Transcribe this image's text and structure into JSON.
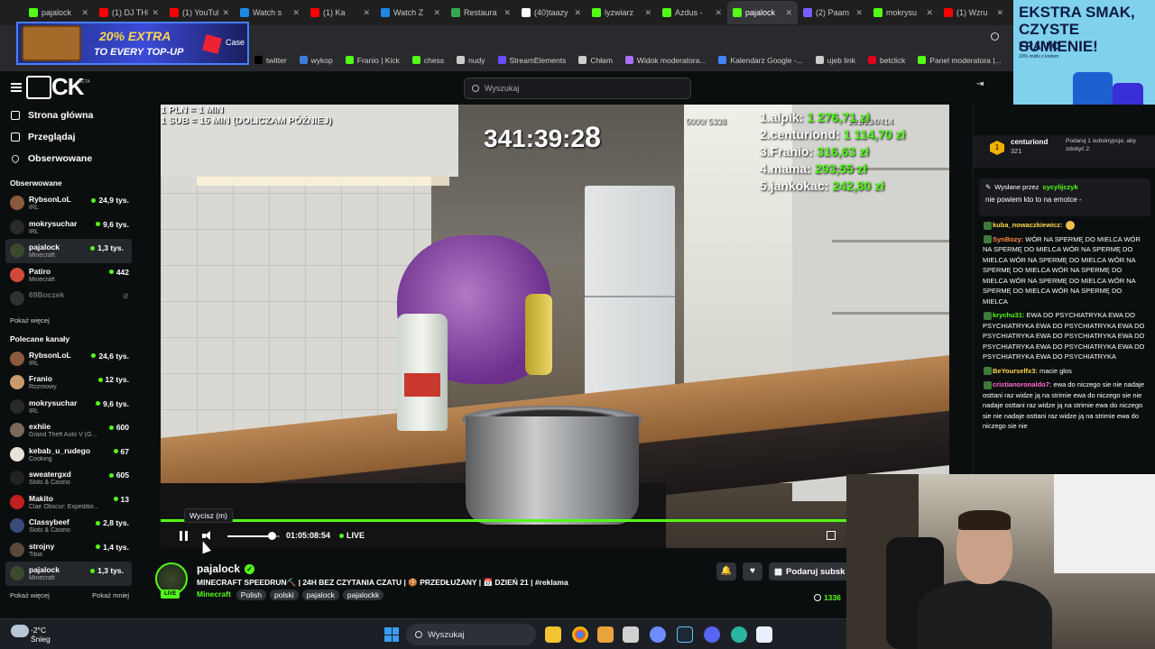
{
  "browser_tabs": [
    {
      "label": "pajalock",
      "color": "#53fc18",
      "active": false
    },
    {
      "label": "(1) DJ THE",
      "color": "#ff0000",
      "active": false
    },
    {
      "label": "(1) YouTube",
      "color": "#ff0000",
      "active": false
    },
    {
      "label": "Watch s",
      "color": "#1e88e5",
      "active": false
    },
    {
      "label": "(1) Ka",
      "color": "#ff0000",
      "active": false
    },
    {
      "label": "Watch Z",
      "color": "#1e88e5",
      "active": false
    },
    {
      "label": "Restaura",
      "color": "#34a853",
      "active": false
    },
    {
      "label": "(40)taazy",
      "color": "#ffffff",
      "active": false
    },
    {
      "label": "lyzwiarz",
      "color": "#53fc18",
      "active": false
    },
    {
      "label": "Azdus -",
      "color": "#53fc18",
      "active": false
    },
    {
      "label": "pajalock",
      "color": "#53fc18",
      "active": true
    },
    {
      "label": "(2) Paam",
      "color": "#7b5cff",
      "active": false
    },
    {
      "label": "mokrysu",
      "color": "#53fc18",
      "active": false
    },
    {
      "label": "(1) Wzru",
      "color": "#ff0000",
      "active": false
    }
  ],
  "bookmarks": [
    {
      "label": "twitter",
      "color": "#000000"
    },
    {
      "label": "wykop",
      "color": "#3b7dd8"
    },
    {
      "label": "Franio | Kick",
      "color": "#53fc18"
    },
    {
      "label": "chess",
      "color": "#53fc18"
    },
    {
      "label": "nudy",
      "color": "#cccccc"
    },
    {
      "label": "StreamElements",
      "color": "#6b4cff"
    },
    {
      "label": "Chłam",
      "color": "#cccccc"
    },
    {
      "label": "Widok moderatora...",
      "color": "#a970ff"
    },
    {
      "label": "Kalendarz Google -...",
      "color": "#4285f4"
    },
    {
      "label": "ujeb link",
      "color": "#cccccc"
    },
    {
      "label": "betclick",
      "color": "#e2001a"
    },
    {
      "label": "Panel moderatora |...",
      "color": "#53fc18"
    }
  ],
  "ad_left": {
    "headline": "20% EXTRA",
    "sub": "TO EVERY TOP-UP",
    "brand": "Case"
  },
  "ad_right": {
    "headline": "EKSTRA SMAK, CZYSTE SUMIENIE!",
    "brand": "FRANIO",
    "sub": "10% zniżki z kodem",
    "badge": "DARMOWA WYSYŁKA!"
  },
  "header": {
    "search_placeholder": "Wyszukaj"
  },
  "nav": [
    {
      "label": "Strona główna",
      "icon": "home-icon"
    },
    {
      "label": "Przeglądaj",
      "icon": "browse-icon"
    },
    {
      "label": "Obserwowane",
      "icon": "heart-icon"
    }
  ],
  "followed_title": "Obserwowane",
  "followed": [
    {
      "name": "RybsonLoL",
      "category": "IRL",
      "viewers": "24,9 tys.",
      "color": "#8a5a3c",
      "selected": false,
      "offline": false
    },
    {
      "name": "mokrysuchar",
      "category": "IRL",
      "viewers": "9,6 tys.",
      "color": "#2a2a2a",
      "selected": false,
      "offline": false
    },
    {
      "name": "pajalock",
      "category": "Minecraft",
      "viewers": "1,3 tys.",
      "color": "#3b4a2c",
      "selected": true,
      "offline": false
    },
    {
      "name": "Patiro",
      "category": "Minecraft",
      "viewers": "442",
      "color": "#d04a3a",
      "selected": false,
      "offline": false
    },
    {
      "name": "69Boczek",
      "category": "",
      "viewers": "",
      "color": "#666666",
      "selected": false,
      "offline": true
    }
  ],
  "show_more_1": "Pokaż więcej",
  "recommended_title": "Polecane kanały",
  "recommended": [
    {
      "name": "RybsonLoL",
      "category": "IRL",
      "viewers": "24,6 tys.",
      "color": "#8a5a3c",
      "selected": false
    },
    {
      "name": "Franio",
      "category": "Rozmowy",
      "viewers": "12 tys.",
      "color": "#c99a6a",
      "selected": false
    },
    {
      "name": "mokrysuchar",
      "category": "IRL",
      "viewers": "9,6 tys.",
      "color": "#2a2a2a",
      "selected": false
    },
    {
      "name": "exhiie",
      "category": "Grand Theft Auto V (G...",
      "viewers": "600",
      "color": "#7a6a5a",
      "selected": false
    },
    {
      "name": "kebab_u_rudego",
      "category": "Cooking",
      "viewers": "67",
      "color": "#e8e2d6",
      "selected": false
    },
    {
      "name": "sweatergxd",
      "category": "Slots & Casino",
      "viewers": "605",
      "color": "#222222",
      "selected": false
    },
    {
      "name": "Makito",
      "category": "Clair Obscur: Expeditio...",
      "viewers": "13",
      "color": "#c02020",
      "selected": false
    },
    {
      "name": "Classybeef",
      "category": "Slots & Casino",
      "viewers": "2,8 tys.",
      "color": "#3a4a7a",
      "selected": false
    },
    {
      "name": "strojny",
      "category": "Tibia",
      "viewers": "1,4 tys.",
      "color": "#5a4a3a",
      "selected": false
    },
    {
      "name": "pajalock",
      "category": "Minecraft",
      "viewers": "1,3 tys.",
      "color": "#3b4a2c",
      "selected": true
    }
  ],
  "show_more_2": "Pokaż więcej",
  "show_less": "Pokaż mniej",
  "overlay": {
    "rule1": "1 PLN = 1 MIN",
    "rule2": "1 SUB = 15 MIN (DOLICZAM PÓŹNIEJ)",
    "timer": "341:39:2",
    "timer_last": "8",
    "stats1": "5000/ 5338",
    "stats2": "201/234/414",
    "leaderboard": [
      {
        "label": "1.alpik:",
        "amount": "1 276,71 zł"
      },
      {
        "label": "2.centuriond:",
        "amount": "1 114,70 zł"
      },
      {
        "label": "3.Franio:",
        "amount": "316,63 zł"
      },
      {
        "label": "4.mama:",
        "amount": "293,55 zł"
      },
      {
        "label": "5.jankokac:",
        "amount": "242,80 zł"
      }
    ]
  },
  "player": {
    "tooltip": "Wycisz (m)",
    "time": "01:05:08:54",
    "live_label": "LIVE",
    "volume_level": 0.85,
    "progress_level": 1.0
  },
  "channel": {
    "name": "pajalock",
    "live_badge": "LIVE",
    "title": "MINECRAFT SPEEDRUN⛏️ | 24H BEZ CZYTANIA CZATU | 🍪 PRZEDŁUŻANY | 📅 DZIEŃ 21 | #reklama",
    "category": "Minecraft",
    "tags": [
      "Polish",
      "polski",
      "pajalock",
      "pajalockk"
    ],
    "gift_button": "Podaruj subsk",
    "viewers": "1336"
  },
  "chat": {
    "top_user": "centuriond",
    "top_amount": "321",
    "gift_message": "Podaruj 1 subskrypcje, aby zdobyć 2.",
    "pinned_by_label": "Wysłane przez",
    "pinned_by_user": "sycylijczyk",
    "pinned_message": "nie powiem kto to na emotce -",
    "messages": [
      {
        "user": "kuba_nowaczkiewicz:",
        "color": "#ffd84d",
        "text": ""
      },
      {
        "user": "SynBozy:",
        "color": "#ff8a3d",
        "text": "WÓR NA SPERMĘ DO MIELCA WÓR NA SPERMĘ DO MIELCA WÓR NA SPERMĘ DO MIELCA WÓR NA SPERMĘ DO MIELCA WÓR NA SPERMĘ DO MIELCA WÓR NA SPERMĘ DO MIELCA WÓR NA SPERMĘ DO MIELCA WÓR NA SPERMĘ DO MIELCA WÓR NA SPERMĘ DO MIELCA"
      },
      {
        "user": "krychu31:",
        "color": "#53fc18",
        "text": "EWA DO PSYCHIATRYKA EWA DO PSYCHIATRYKA EWA DO PSYCHIATRYKA EWA DO PSYCHIATRYKA EWA DO PSYCHIATRYKA EWA DO PSYCHIATRYKA EWA DO PSYCHIATRYKA EWA DO PSYCHIATRYKA EWA DO PSYCHIATRYKA"
      },
      {
        "user": "BeYourselfx3:",
        "color": "#ffd84d",
        "text": "macie glos"
      },
      {
        "user": "cristianoronaldo7:",
        "color": "#ff6ad5",
        "text": "ewa do niczego sie nie nadaje osttani raz widze ją na strimie ewa do niczego sie nie nadaje osttani raz widze ją na strimie ewa do niczego sie nie nadaje osttani raz widze ją na strimie ewa do niczego sie nie"
      }
    ]
  },
  "taskbar": {
    "temp": "-2°C",
    "weather": "Śnieg",
    "search": "Wyszukaj"
  }
}
